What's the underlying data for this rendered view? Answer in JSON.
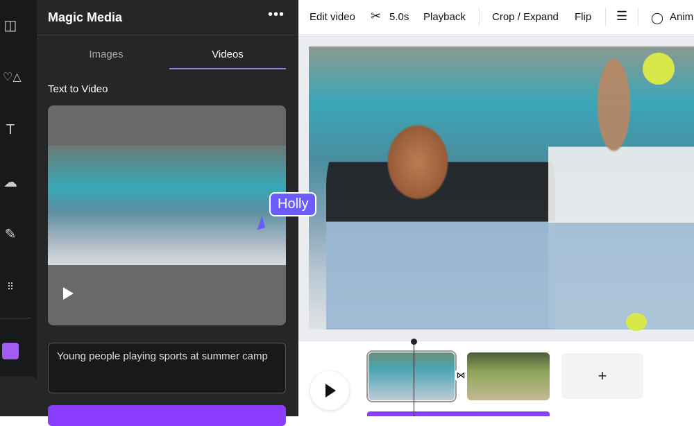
{
  "rail": {
    "items": [
      "layout-icon",
      "elements-icon",
      "text-icon",
      "upload-icon",
      "draw-icon",
      "apps-icon",
      "magic-media-icon"
    ]
  },
  "panel": {
    "title": "Magic Media",
    "more": "•••",
    "tabs": [
      {
        "label": "Images"
      },
      {
        "label": "Videos",
        "active": true
      }
    ],
    "section": "Text to Video",
    "prompt": "Young people playing sports at summer camp"
  },
  "toolbar": {
    "edit_video": "Edit video",
    "duration": "5.0s",
    "playback": "Playback",
    "crop": "Crop / Expand",
    "flip": "Flip",
    "animate": "Anim"
  },
  "collab": {
    "name": "Holly"
  },
  "timeline": {
    "add": "+",
    "transition": "⋈"
  },
  "colors": {
    "accent": "#8b3dff",
    "tab_underline": "#9b7de0",
    "collab": "#6a5cff"
  }
}
